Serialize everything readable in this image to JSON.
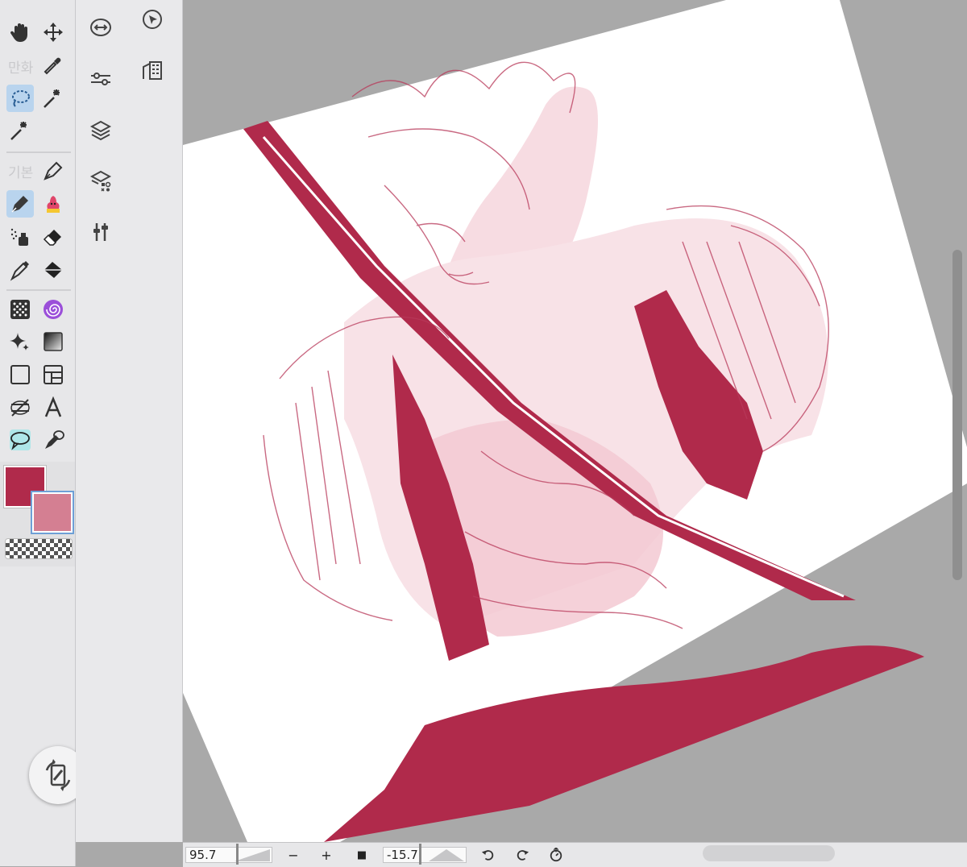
{
  "toolbar": {
    "section_manga": "만화",
    "section_basic": "기본",
    "tools": [
      {
        "name": "hand-icon"
      },
      {
        "name": "move-icon"
      },
      {
        "name": "lasso-icon"
      },
      {
        "name": "eyedropper-icon"
      },
      {
        "name": "magic-wand-icon"
      },
      {
        "name": "sparkle-icon"
      },
      {
        "name": "pen-nib-icon"
      },
      {
        "name": "pen-icon"
      },
      {
        "name": "ice-cream-brush-icon"
      },
      {
        "name": "airbrush-icon"
      },
      {
        "name": "eraser-icon"
      },
      {
        "name": "paint-brush-icon"
      },
      {
        "name": "fill-bucket-icon"
      },
      {
        "name": "dot-pattern-icon"
      },
      {
        "name": "spiral-icon"
      },
      {
        "name": "star-sparkle-icon"
      },
      {
        "name": "gradient-icon"
      },
      {
        "name": "frame-icon"
      },
      {
        "name": "panel-icon"
      },
      {
        "name": "ruler-icon"
      },
      {
        "name": "text-icon"
      },
      {
        "name": "speech-balloon-icon"
      },
      {
        "name": "balloon-pen-icon"
      }
    ],
    "main_color": "#b02a4b",
    "sub_color": "#d47f92"
  },
  "toolbar2": {
    "items": [
      "undo-redo-icon",
      "adjust-icon",
      "layers-icon",
      "material-icon",
      "settings-icon",
      "select-icon",
      "buildings-icon"
    ]
  },
  "status": {
    "zoom": "95.7",
    "angle": "-15.7",
    "minus": "−",
    "plus": "+",
    "fit": "■"
  },
  "colors": {
    "accent": "#b02a4b",
    "pink": "#d47f92",
    "light_pink": "#f3cfd7"
  }
}
